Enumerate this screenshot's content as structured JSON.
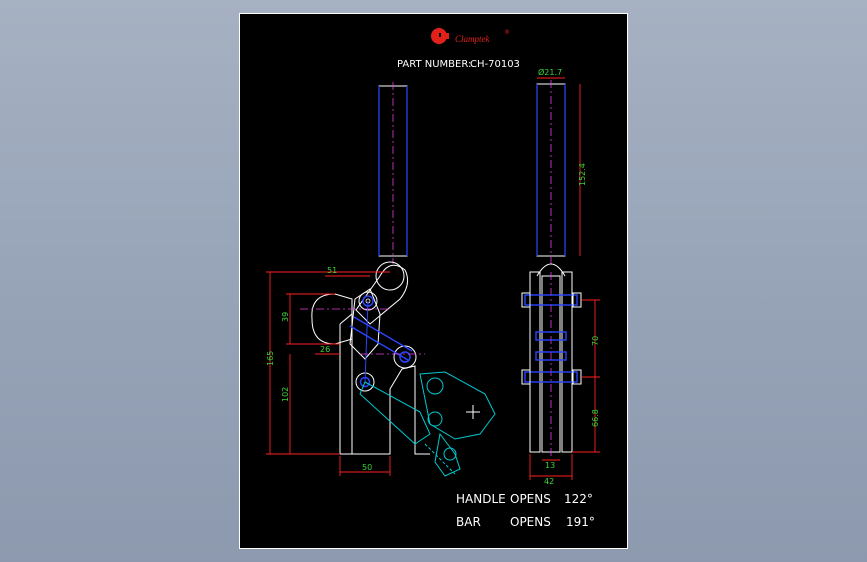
{
  "brand": {
    "name": "Clamptek",
    "registered_mark": "®",
    "logo_color": "#e3211b"
  },
  "part": {
    "label": "PART NUMBER:",
    "number": "CH-70103"
  },
  "dimensions": {
    "handle_diameter": "Ø21.7",
    "handle_length": "152.4",
    "horiz_51": "51",
    "horiz_26": "26",
    "horiz_50": "50",
    "vert_39": "39",
    "vert_165": "165",
    "vert_102": "102",
    "vert_70": "70",
    "vert_66_8": "66.8",
    "width_13": "13",
    "width_42": "42"
  },
  "specs": [
    {
      "name": "HANDLE",
      "action": "OPENS",
      "value": "122°"
    },
    {
      "name": "BAR",
      "action": "OPENS",
      "value": "191°"
    }
  ],
  "colors": {
    "frame": "#ffffff",
    "outline": "#ffffff",
    "dimension_line": "#ff2020",
    "dimension_text": "#39d639",
    "center_line": "#e040e0",
    "pivot": "#2a45ff",
    "alt_position": "#00c8d0",
    "background": "#000000"
  }
}
